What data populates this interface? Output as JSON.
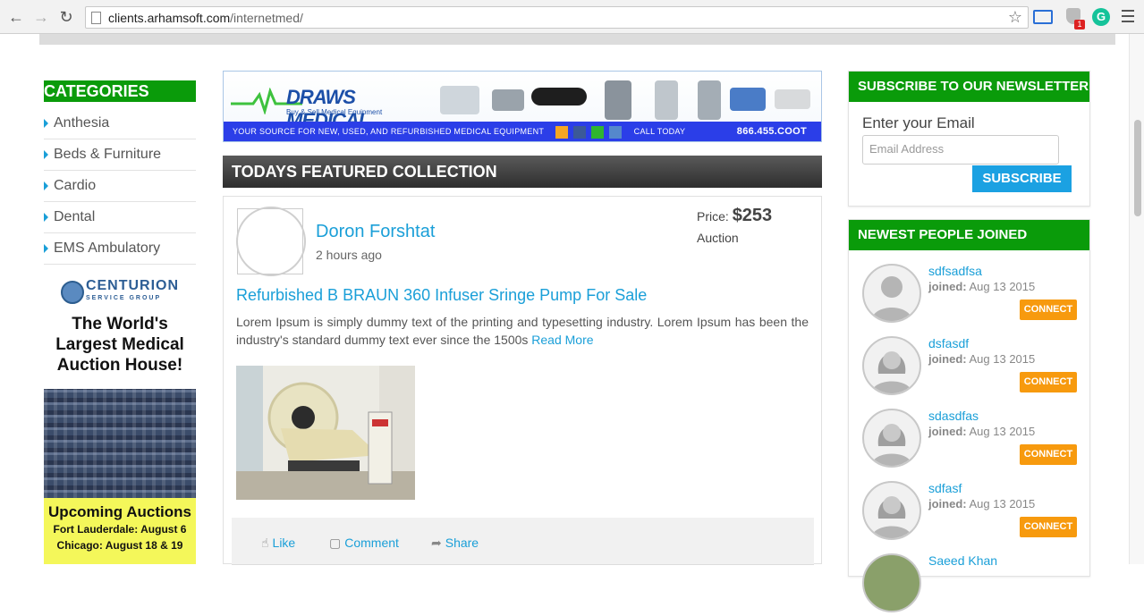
{
  "browser": {
    "url_host": "clients.arhamsoft.com",
    "url_path": "/internetmed/",
    "ext_badge": "1",
    "ext_g": "G"
  },
  "sidebar": {
    "heading": "CATEGORIES",
    "items": [
      "Anthesia",
      "Beds & Furniture",
      "Cardio",
      "Dental",
      "EMS Ambulatory"
    ]
  },
  "ad": {
    "brand": "CENTURION",
    "brand_sub": "SERVICE GROUP",
    "tagline": "The World's Largest Medical Auction House!",
    "upcoming": "Upcoming Auctions",
    "loc1": "Fort Lauderdale: August 6",
    "loc2": "Chicago: August 18 & 19"
  },
  "banner": {
    "brand": "DRAWS MEDICAL",
    "sub": "Buy & Sell Medical Equipment",
    "strip_text": "YOUR SOURCE FOR NEW, USED, AND REFURBISHED MEDICAL EQUIPMENT",
    "phone": "866.455.COOT",
    "call_text": "CALL TODAY"
  },
  "featured": {
    "heading": "TODAYS FEATURED COLLECTION",
    "author": "Doron Forshtat",
    "time": "2 hours ago",
    "price_label": "Price:",
    "price_value": "$253",
    "price_type": "Auction",
    "title": "Refurbished B BRAUN 360 Infuser Sringe Pump For Sale",
    "description": "Lorem Ipsum is simply dummy text of the printing and typesetting industry. Lorem Ipsum has been the industry's standard dummy text ever since the 1500s",
    "read_more": "Read More",
    "like": "Like",
    "comment": "Comment",
    "share": "Share"
  },
  "newsletter": {
    "heading": "SUBSCRIBE TO OUR NEWSLETTER",
    "label": "Enter your Email",
    "placeholder": "Email Address",
    "button": "SUBSCRIBE"
  },
  "people": {
    "heading": "NEWEST PEOPLE JOINED",
    "joined_label": "joined:",
    "connect": "CONNECT",
    "list": [
      {
        "name": "sdfsadfsa",
        "date": "Aug 13 2015",
        "gender": "male"
      },
      {
        "name": "dsfasdf",
        "date": "Aug 13 2015",
        "gender": "female"
      },
      {
        "name": "sdasdfas",
        "date": "Aug 13 2015",
        "gender": "female"
      },
      {
        "name": "sdfasf",
        "date": "Aug 13 2015",
        "gender": "female"
      },
      {
        "name": "Saeed Khan",
        "date": "",
        "gender": "photo"
      }
    ]
  },
  "colors": {
    "green": "#0a9b0a",
    "blue_link": "#1a9fd8",
    "orange": "#f79a0e"
  }
}
